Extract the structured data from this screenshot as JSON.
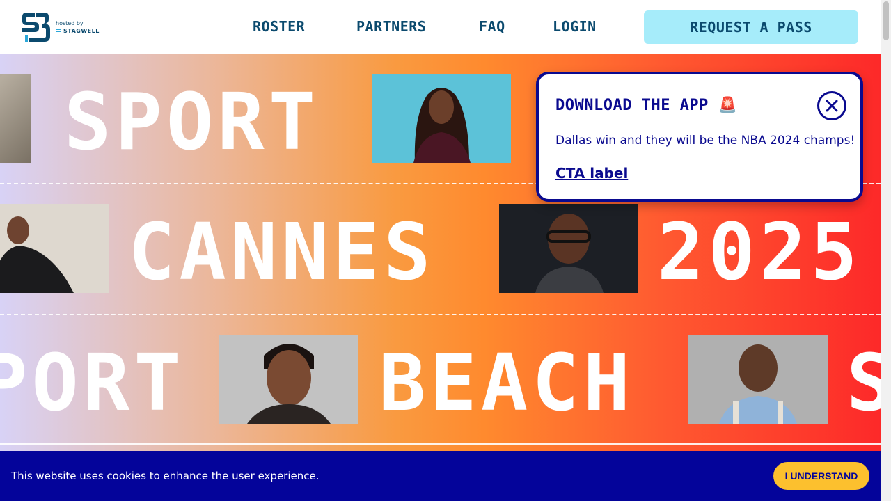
{
  "header": {
    "logo_hosted": "hosted by",
    "logo_brand": "STAGWELL",
    "nav": [
      {
        "label": "ROSTER"
      },
      {
        "label": "PARTNERS"
      },
      {
        "label": "FAQ"
      },
      {
        "label": "LOGIN"
      }
    ],
    "cta_label": "REQUEST A PASS"
  },
  "hero": {
    "row1": {
      "word": "SPORT"
    },
    "row2": {
      "word1": "CANNES",
      "word2": "2025"
    },
    "row3": {
      "word1": "PORT",
      "word2": "BEACH",
      "word3": "S"
    }
  },
  "popup": {
    "title": "DOWNLOAD THE APP 🚨",
    "body": "Dallas win and they will be the NBA 2024 champs!",
    "cta": "CTA label",
    "close_icon": "close-icon"
  },
  "cookie": {
    "text": "This website uses cookies to enhance the user experience.",
    "button": "I UNDERSTAND"
  },
  "colors": {
    "navy": "#0b4a6e",
    "cta_bg": "#a6ecfa",
    "popup_accent": "#0a0a8f",
    "cookie_bg": "#04049a",
    "cookie_button": "#fcc02e"
  }
}
